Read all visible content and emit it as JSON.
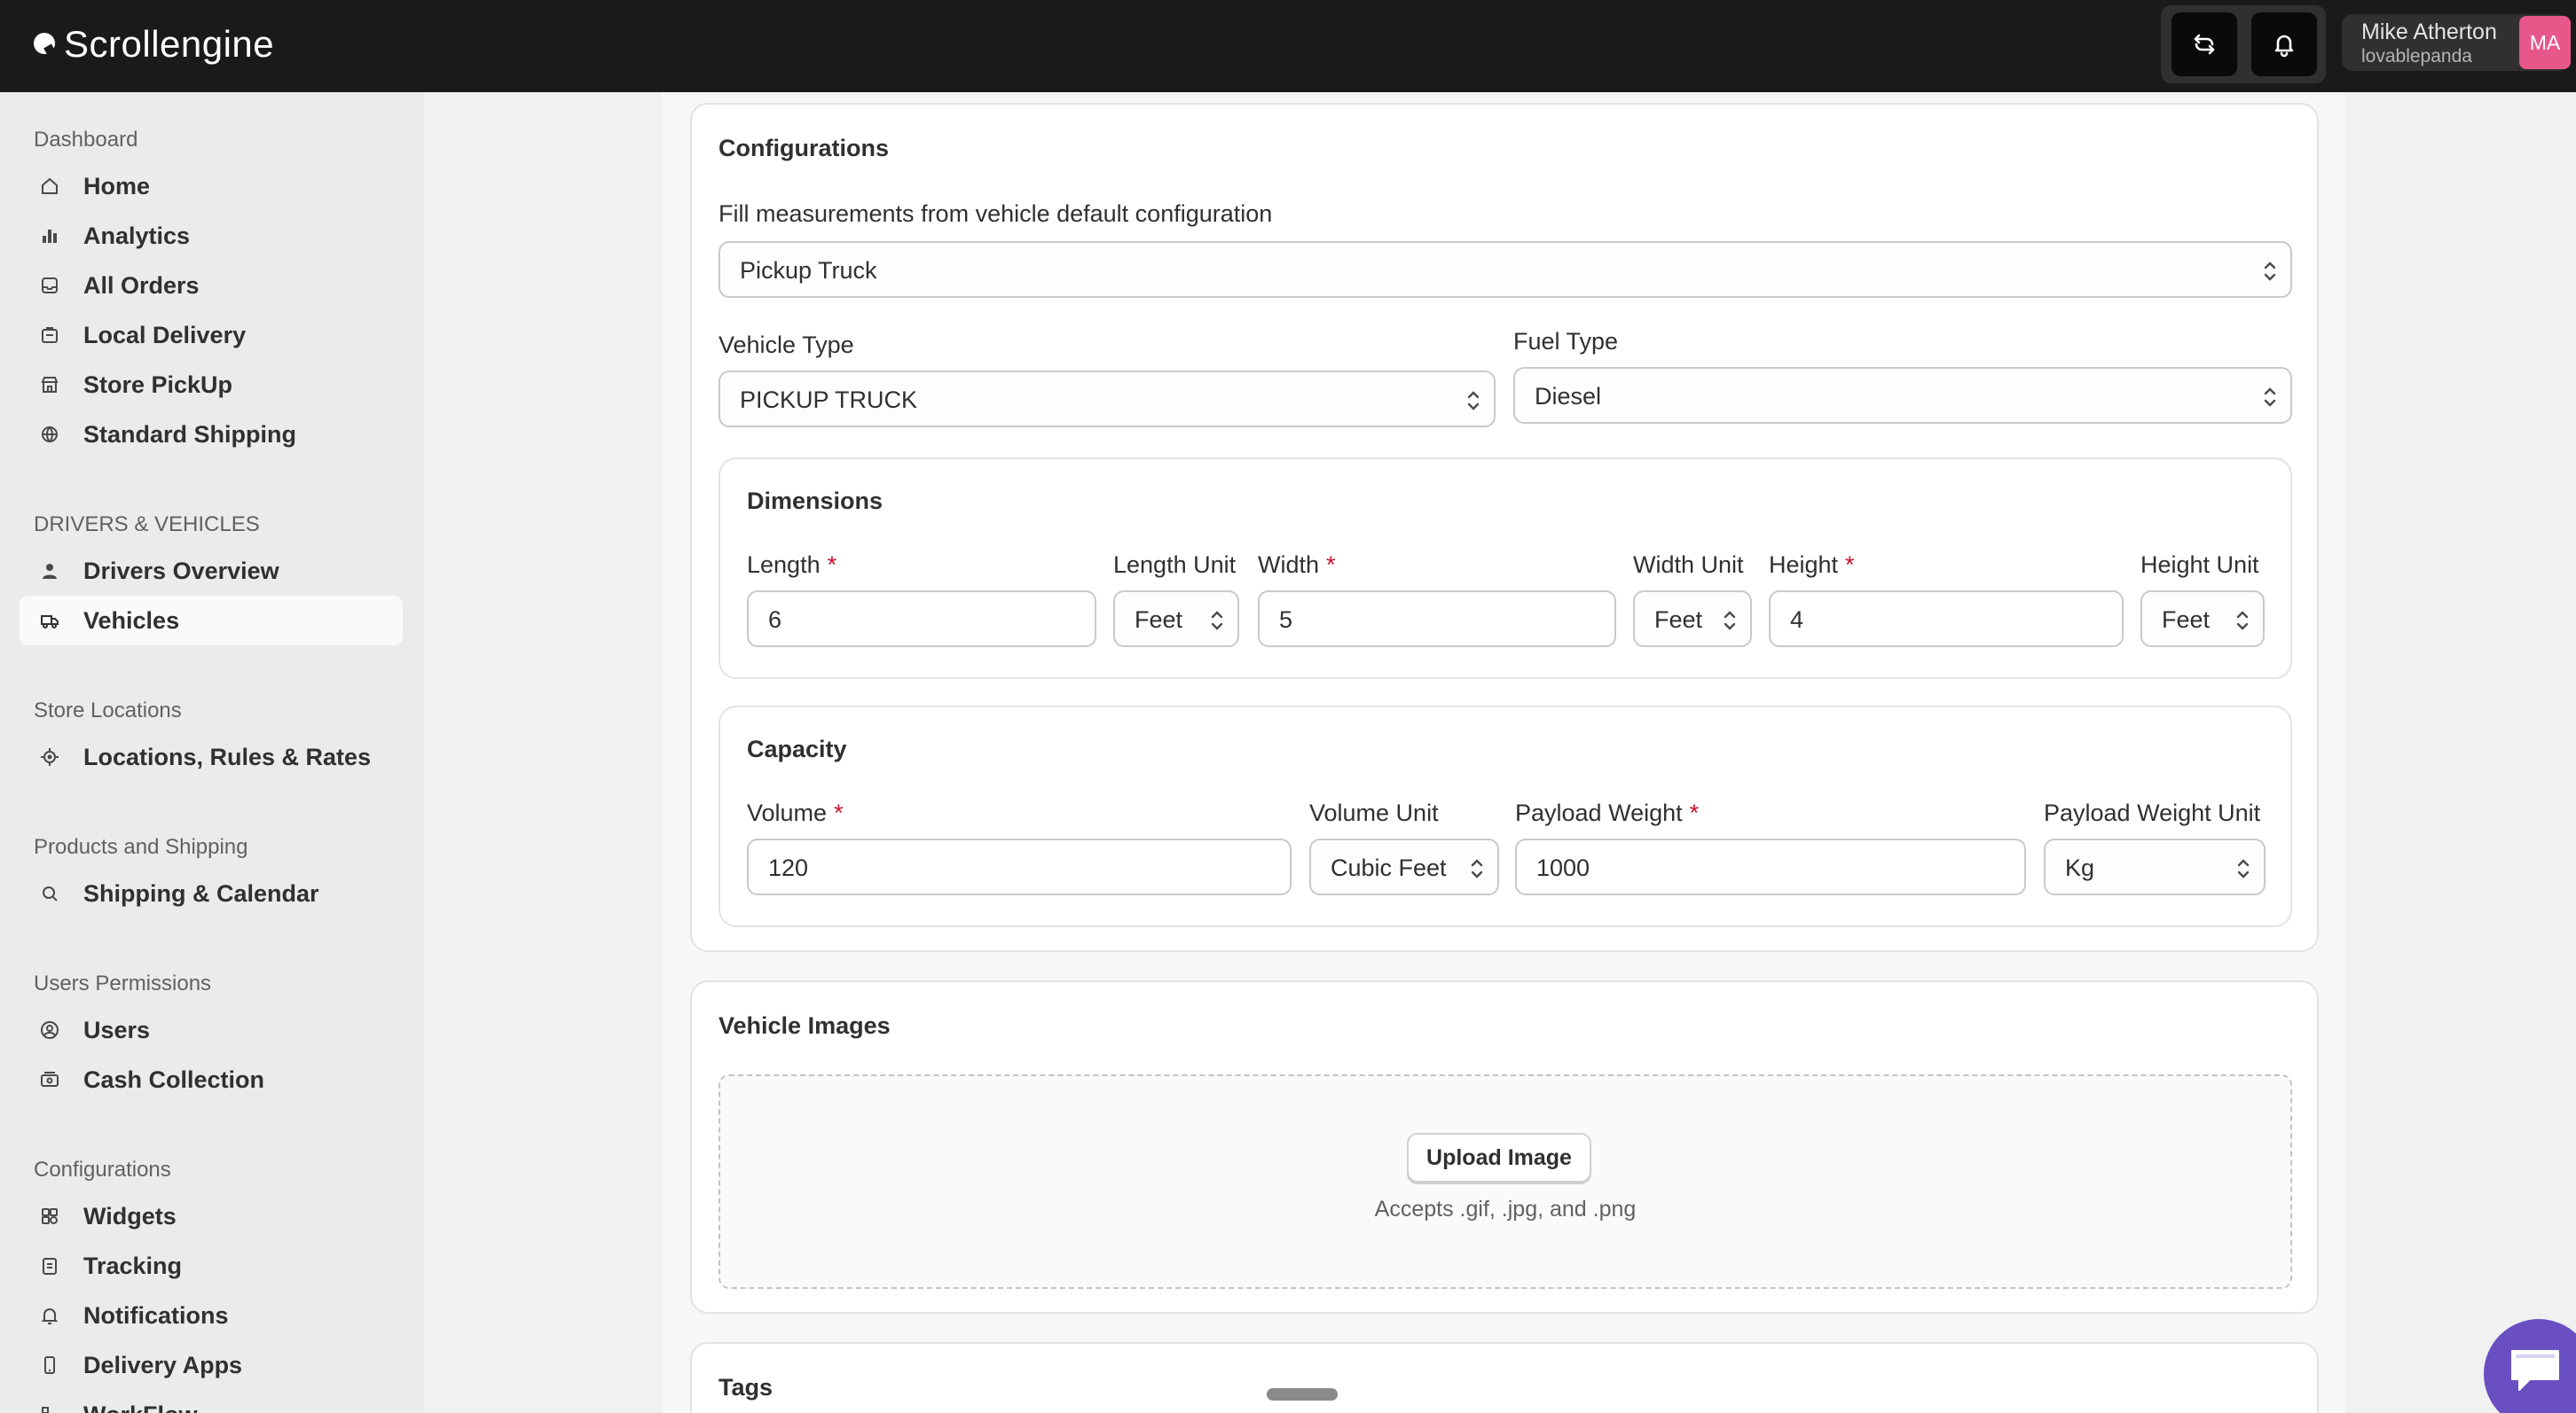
{
  "app": {
    "brand": "Scrollengine"
  },
  "header": {
    "user": {
      "name": "Mike Atherton",
      "handle": "lovablepanda",
      "initials": "MA"
    }
  },
  "sidebar": {
    "sections": [
      {
        "title": "Dashboard",
        "items": [
          "Home",
          "Analytics",
          "All Orders",
          "Local Delivery",
          "Store PickUp",
          "Standard Shipping"
        ]
      },
      {
        "title": "DRIVERS & VEHICLES",
        "items": [
          "Drivers Overview",
          "Vehicles"
        ]
      },
      {
        "title": "Store Locations",
        "items": [
          "Locations, Rules & Rates"
        ]
      },
      {
        "title": "Products and Shipping",
        "items": [
          "Shipping & Calendar"
        ]
      },
      {
        "title": "Users Permissions",
        "items": [
          "Users",
          "Cash Collection"
        ]
      },
      {
        "title": "Configurations",
        "items": [
          "Widgets",
          "Tracking",
          "Notifications",
          "Delivery Apps",
          "WorkFlow"
        ]
      }
    ],
    "active_item": "Vehicles"
  },
  "configurations": {
    "title": "Configurations",
    "default_config_label": "Fill measurements from vehicle default configuration",
    "default_config_value": "Pickup Truck",
    "vehicle_type_label": "Vehicle Type",
    "vehicle_type_value": "PICKUP TRUCK",
    "fuel_type_label": "Fuel Type",
    "fuel_type_value": "Diesel",
    "required_mark": "*",
    "dimensions": {
      "title": "Dimensions",
      "length_label": "Length",
      "length_value": "6",
      "length_unit_label": "Length Unit",
      "length_unit_value": "Feet",
      "width_label": "Width",
      "width_value": "5",
      "width_unit_label": "Width Unit",
      "width_unit_value": "Feet",
      "height_label": "Height",
      "height_value": "4",
      "height_unit_label": "Height Unit",
      "height_unit_value": "Feet"
    },
    "capacity": {
      "title": "Capacity",
      "volume_label": "Volume",
      "volume_value": "120",
      "volume_unit_label": "Volume Unit",
      "volume_unit_value": "Cubic Feet",
      "payload_label": "Payload Weight",
      "payload_value": "1000",
      "payload_unit_label": "Payload Weight Unit",
      "payload_unit_value": "Kg"
    }
  },
  "vehicle_images": {
    "title": "Vehicle Images",
    "upload_label": "Upload Image",
    "accepts_text": "Accepts .gif, .jpg, and .png"
  },
  "tags": {
    "title": "Tags"
  },
  "colors": {
    "topbar": "#1a1a1a",
    "avatar": "#e8578a",
    "chat_fab": "#6a4fc3",
    "required": "#c8102e"
  }
}
